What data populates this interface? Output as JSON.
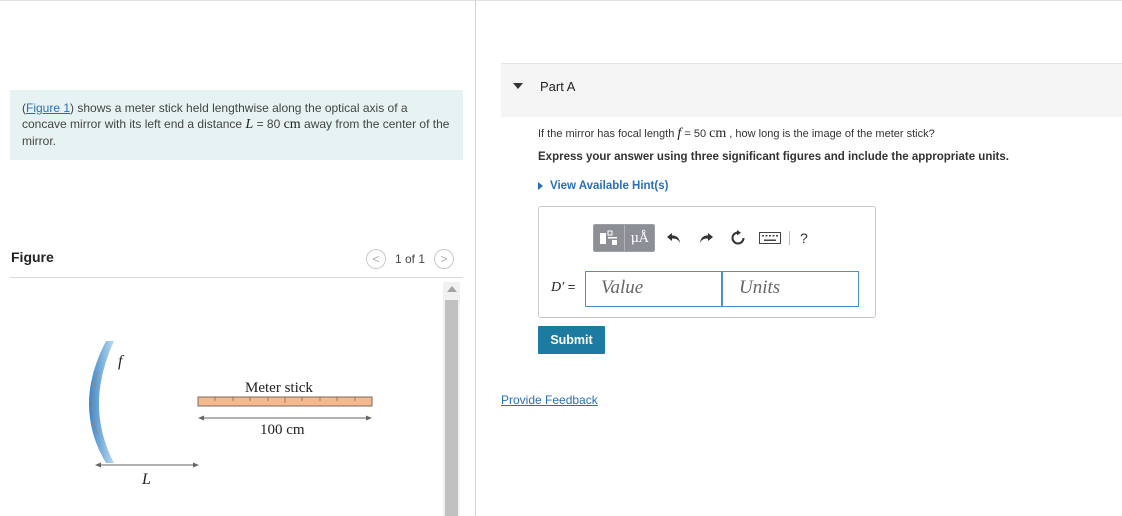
{
  "intro": {
    "link": "Figure 1",
    "open_paren": "(",
    "text1": ") shows a meter stick held lengthwise along the optical axis of a concave mirror with its left end a distance ",
    "var": "L",
    "eq": " = 80 ",
    "unit": "cm",
    "text2": " away from the center of the mirror."
  },
  "figure_panel": {
    "title": "Figure",
    "pager": {
      "prev": "<",
      "text": "1 of 1",
      "next": ">"
    },
    "labels": {
      "focal": "f",
      "meter_stick": "Meter stick",
      "length": "100 cm",
      "distance": "L"
    }
  },
  "part": {
    "title": "Part A",
    "question": {
      "pre": "If the mirror has focal length ",
      "var": "f",
      "eq": " = 50 ",
      "unit": "cm",
      "post": " , how long is the image of the meter stick?"
    },
    "instruction": "Express your answer using three significant figures and include the appropriate units.",
    "hint": "View Available Hint(s)",
    "toolbar": {
      "mu_label": "μÅ",
      "help": "?"
    },
    "answer_label": {
      "var": "D′",
      "eq": " ="
    },
    "value_placeholder": "Value",
    "units_placeholder": "Units",
    "submit": "Submit",
    "feedback": "Provide Feedback"
  },
  "colors": {
    "accent": "#2a6ebb",
    "submit_bg": "#1d7ba1",
    "intro_bg": "#e7f3f3",
    "stick": "#f5b98d"
  }
}
